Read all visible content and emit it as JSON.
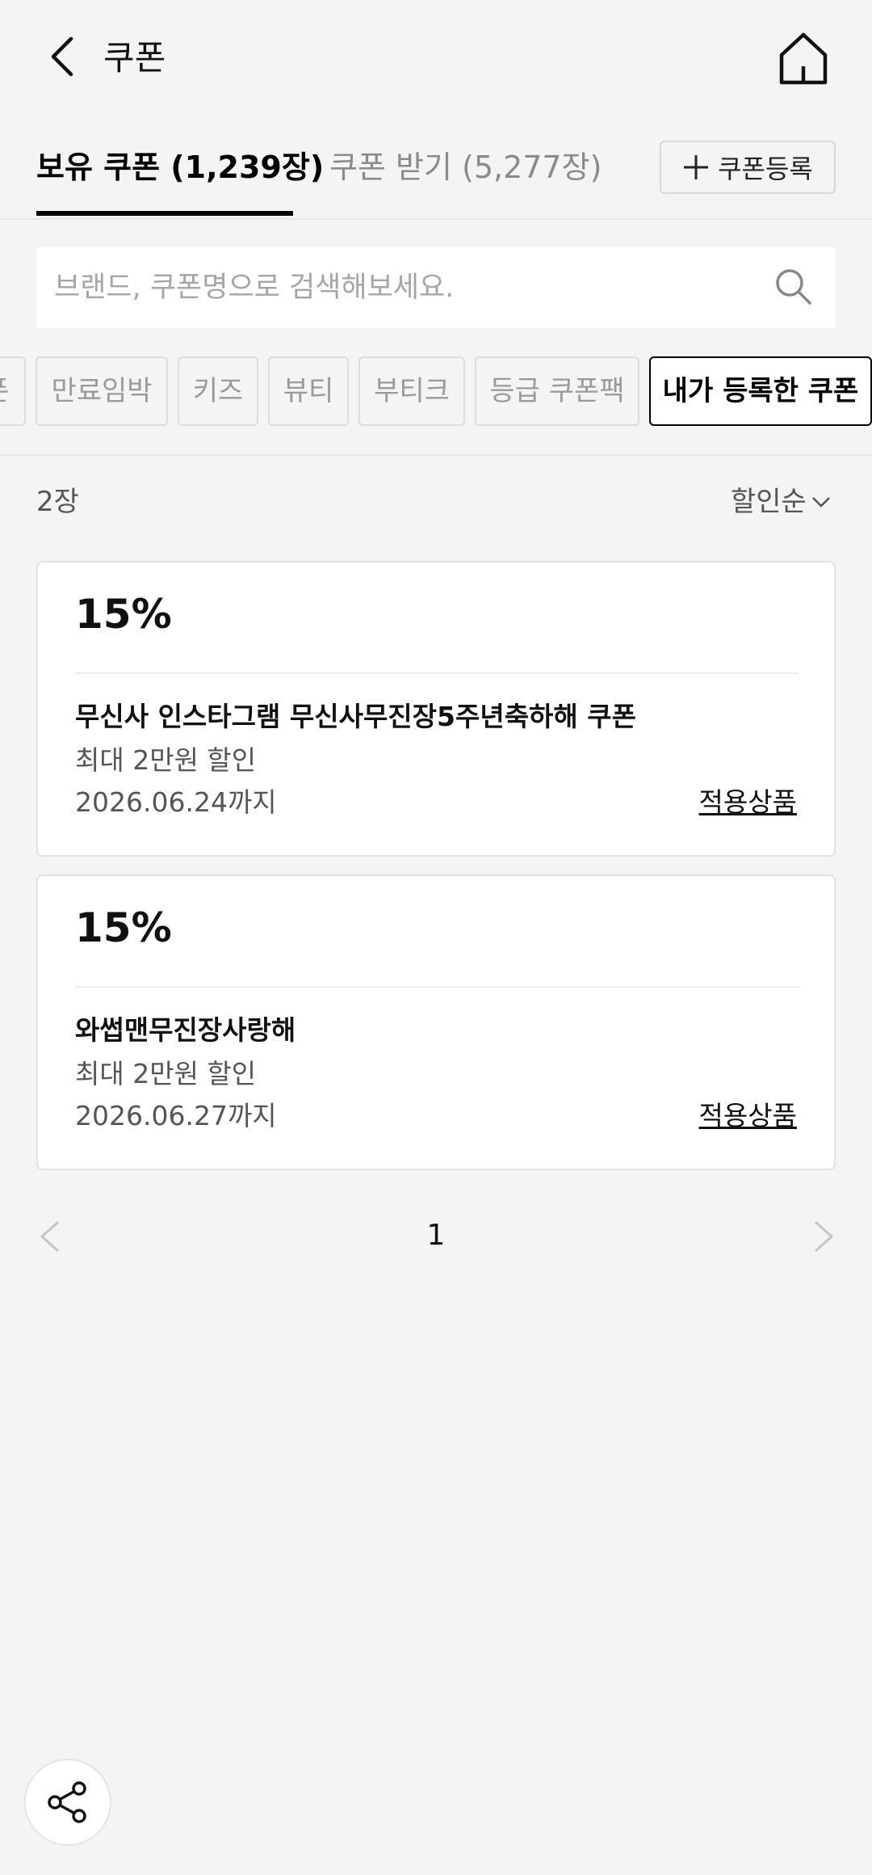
{
  "header": {
    "title": "쿠폰"
  },
  "tabs": {
    "owned": "보유 쿠폰 (1,239장)",
    "receive": "쿠폰 받기 (5,277장)",
    "register": "쿠폰등록"
  },
  "search": {
    "placeholder": "브랜드, 쿠폰명으로 검색해보세요."
  },
  "chips": [
    "폰",
    "만료임박",
    "키즈",
    "뷰티",
    "부티크",
    "등급 쿠폰팩",
    "내가 등록한 쿠폰"
  ],
  "list": {
    "count": "2장",
    "sort": "할인순"
  },
  "coupons": [
    {
      "discount": "15%",
      "name": "무신사 인스타그램 무신사무진장5주년축하해 쿠폰",
      "max": "최대 2만원 할인",
      "date": "2026.06.24까지",
      "link": "적용상품"
    },
    {
      "discount": "15%",
      "name": "와썹맨무진장사랑해",
      "max": "최대 2만원 할인",
      "date": "2026.06.27까지",
      "link": "적용상품"
    }
  ],
  "pagination": {
    "current": "1"
  },
  "icons": [
    "back-icon",
    "home-icon",
    "plus-icon",
    "search-icon",
    "chevron-down-icon",
    "chevron-left-icon",
    "chevron-right-icon",
    "share-icon"
  ]
}
